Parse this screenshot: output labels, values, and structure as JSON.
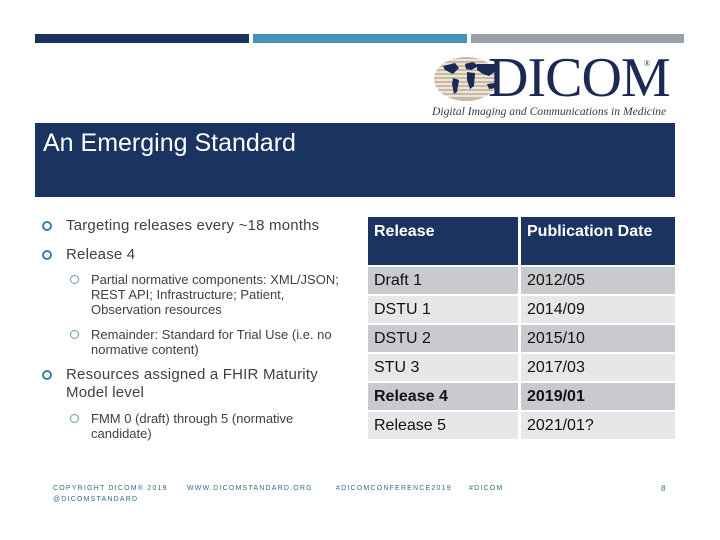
{
  "logo": {
    "wordmark": "DICOM",
    "registered": "®",
    "tagline": "Digital Imaging and Communications in Medicine"
  },
  "colors": {
    "navy": "#1b3360",
    "accent_blue": "#4593bd",
    "gray": "#9aa1a9",
    "bullet": "#3a7fa6",
    "footer_text": "#2e6f85"
  },
  "title": "An Emerging Standard",
  "bullets": [
    {
      "text": "Targeting releases every ~18 months",
      "sub": []
    },
    {
      "text": "Release 4",
      "sub": [
        "Partial normative components: XML/JSON; REST API; Infrastructure; Patient, Observation resources",
        "Remainder: Standard for Trial Use (i.e. no normative content)"
      ]
    },
    {
      "text": "Resources assigned a FHIR Maturity Model level",
      "sub": [
        "FMM 0 (draft) through 5 (normative candidate)"
      ]
    }
  ],
  "table": {
    "headers": [
      "Release",
      "Publication Date"
    ],
    "rows": [
      {
        "release": "Draft 1",
        "date": "2012/05",
        "bold": false
      },
      {
        "release": "DSTU 1",
        "date": "2014/09",
        "bold": false
      },
      {
        "release": "DSTU 2",
        "date": "2015/10",
        "bold": false
      },
      {
        "release": "STU 3",
        "date": "2017/03",
        "bold": false
      },
      {
        "release": "Release 4",
        "date": "2019/01",
        "bold": true
      },
      {
        "release": "Release 5",
        "date": "2021/01?",
        "bold": false
      }
    ]
  },
  "footer": {
    "copyright": "COPYRIGHT DICOM® 2019",
    "handle": "@DICOMSTANDARD",
    "website": "WWW.DICOMSTANDARD.ORG",
    "hashtag_conference": "#DICOMCONFERENCE2019",
    "hashtag": "#DICOM",
    "page_number": "8"
  }
}
